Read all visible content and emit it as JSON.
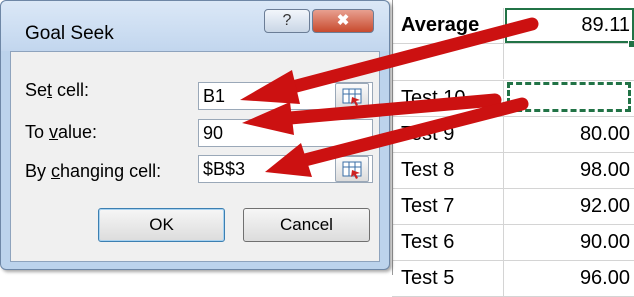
{
  "dialog": {
    "title": "Goal Seek",
    "help_symbol": "?",
    "close_symbol": "✖",
    "fields": [
      {
        "label_pre": "Se",
        "label_ul": "t",
        "label_post": " cell:",
        "value": "B1"
      },
      {
        "label_pre": "To ",
        "label_ul": "v",
        "label_post": "alue:",
        "value": "90"
      },
      {
        "label_pre": "By ",
        "label_ul": "c",
        "label_post": "hanging cell:",
        "value": "$B$3"
      }
    ],
    "ok_label": "OK",
    "cancel_label": "Cancel"
  },
  "sheet": {
    "rows": [
      {
        "label": "Average",
        "value": "89.11"
      },
      {
        "label": "",
        "value": ""
      },
      {
        "label": "Test 10",
        "value": ""
      },
      {
        "label": "Test 9",
        "value": "80.00"
      },
      {
        "label": "Test 8",
        "value": "98.00"
      },
      {
        "label": "Test 7",
        "value": "92.00"
      },
      {
        "label": "Test 6",
        "value": "90.00"
      },
      {
        "label": "Test 5",
        "value": "96.00"
      }
    ]
  },
  "colors": {
    "selection": "#217346",
    "arrow": "#cc1111",
    "dialog_frame": "#bcd3ec"
  }
}
